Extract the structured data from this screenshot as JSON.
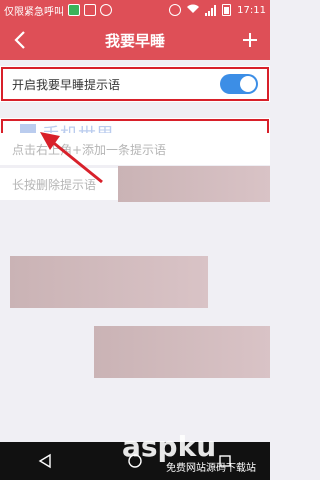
{
  "status_bar": {
    "carrier": "仅限紧急呼叫",
    "time": "17:11"
  },
  "header": {
    "title": "我要早睡"
  },
  "settings": {
    "toggle_label": "开启我要早睡提示语",
    "toggle_on": true,
    "hint_add": "点击右上角+添加一条提示语",
    "hint_delete": "长按删除提示语"
  },
  "watermark": {
    "text": "手机世界"
  },
  "site_watermark": {
    "logo": "aspku",
    "tagline": "免费网站源码下载站"
  },
  "colors": {
    "header_red": "#de4f57",
    "toggle_blue": "#3c8ee6",
    "highlight_red": "#d8202a"
  }
}
